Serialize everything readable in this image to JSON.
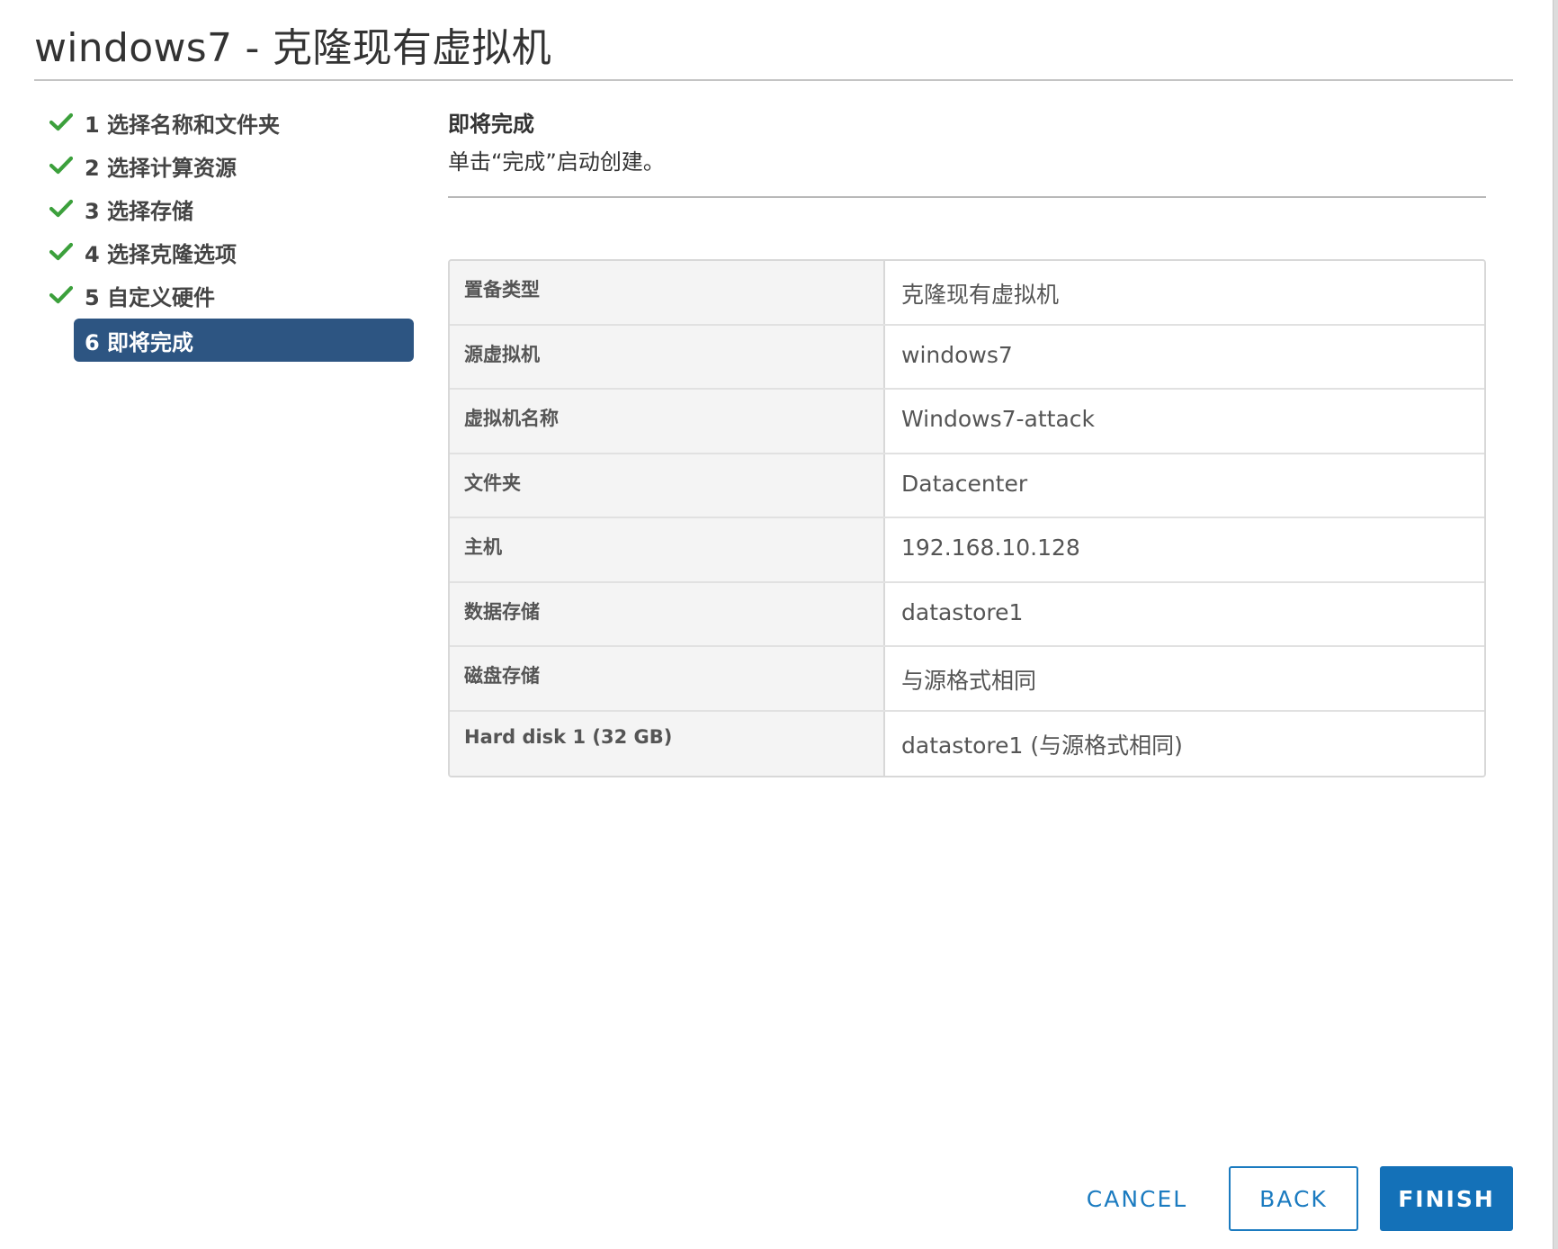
{
  "dialog": {
    "title": "windows7 - 克隆现有虚拟机"
  },
  "steps": [
    {
      "label": "1 选择名称和文件夹",
      "completed": true
    },
    {
      "label": "2 选择计算资源",
      "completed": true
    },
    {
      "label": "3 选择存储",
      "completed": true
    },
    {
      "label": "4 选择克隆选项",
      "completed": true
    },
    {
      "label": "5 自定义硬件",
      "completed": true
    },
    {
      "label": "6 即将完成",
      "completed": false,
      "active": true
    }
  ],
  "content": {
    "heading": "即将完成",
    "subtitle": "单击“完成”启动创建。"
  },
  "summary": [
    {
      "key": "置备类型",
      "value": "克隆现有虚拟机"
    },
    {
      "key": "源虚拟机",
      "value": "windows7"
    },
    {
      "key": "虚拟机名称",
      "value": "Windows7-attack"
    },
    {
      "key": "文件夹",
      "value": "Datacenter"
    },
    {
      "key": "主机",
      "value": "192.168.10.128"
    },
    {
      "key": "数据存储",
      "value": "datastore1"
    },
    {
      "key": "磁盘存储",
      "value": "与源格式相同"
    },
    {
      "key": "Hard disk 1 (32 GB)",
      "value": "datastore1 (与源格式相同)"
    }
  ],
  "footer": {
    "cancel_label": "CANCEL",
    "back_label": "BACK",
    "finish_label": "FINISH"
  },
  "colors": {
    "check": "#3ca03c",
    "active_step_bg": "#2d5582",
    "primary": "#1471b8",
    "link": "#1b7bc0"
  },
  "icons": {
    "step_completed": "checkmark-icon"
  }
}
